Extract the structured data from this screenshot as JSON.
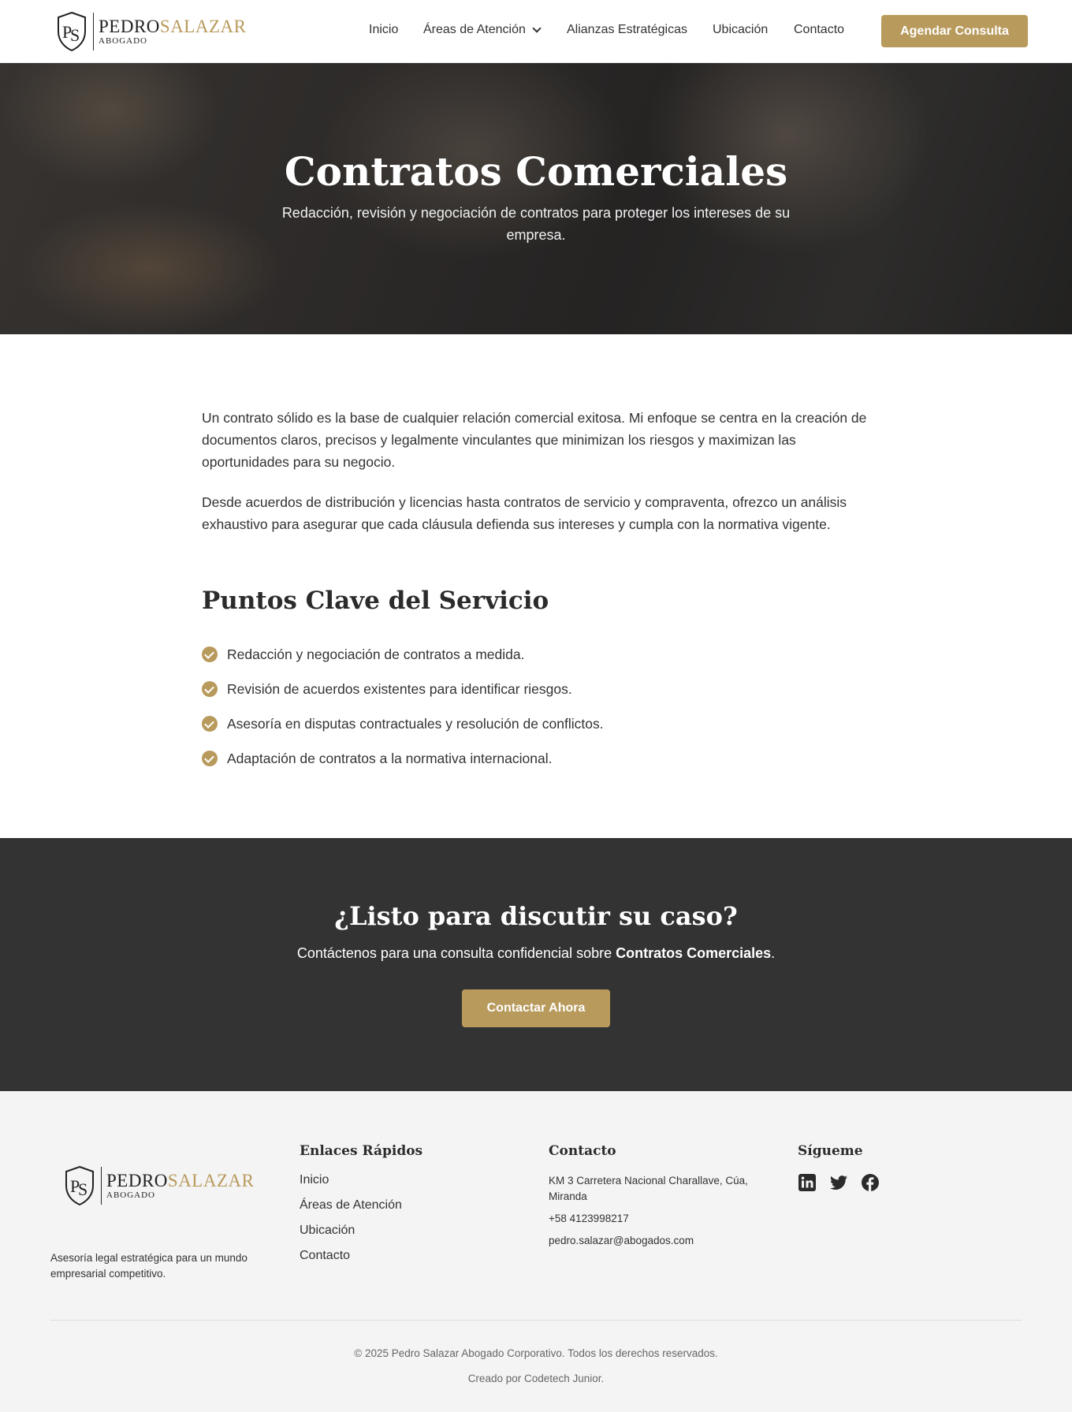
{
  "brand": {
    "first": "PEDRO",
    "last": "SALAZAR",
    "sub": "ABOGADO",
    "accent": "#b89a5c"
  },
  "nav": {
    "items": [
      "Inicio",
      "Áreas de Atención",
      "Alianzas Estratégicas",
      "Ubicación",
      "Contacto"
    ],
    "cta": "Agendar Consulta"
  },
  "hero": {
    "title": "Contratos Comerciales",
    "subtitle": "Redacción, revisión y negociación de contratos para proteger los intereses de su empresa."
  },
  "content": {
    "p1": "Un contrato sólido es la base de cualquier relación comercial exitosa. Mi enfoque se centra en la creación de documentos claros, precisos y legalmente vinculantes que minimizan los riesgos y maximizan las oportunidades para su negocio.",
    "p2": "Desde acuerdos de distribución y licencias hasta contratos de servicio y compraventa, ofrezco un análisis exhaustivo para asegurar que cada cláusula defienda sus intereses y cumpla con la normativa vigente.",
    "key_points_title": "Puntos Clave del Servicio",
    "key_points": [
      "Redacción y negociación de contratos a medida.",
      "Revisión de acuerdos existentes para identificar riesgos.",
      "Asesoría en disputas contractuales y resolución de conflictos.",
      "Adaptación de contratos a la normativa internacional."
    ]
  },
  "cta_band": {
    "title": "¿Listo para discutir su caso?",
    "text_prefix": "Contáctenos para una consulta confidencial sobre ",
    "text_bold": "Contratos Comerciales",
    "text_suffix": ".",
    "button": "Contactar Ahora",
    "bg": "#333333"
  },
  "footer": {
    "tagline": "Asesoría legal estratégica para un mundo empresarial competitivo.",
    "links_title": "Enlaces Rápidos",
    "links": [
      "Inicio",
      "Áreas de Atención",
      "Ubicación",
      "Contacto"
    ],
    "contact_title": "Contacto",
    "address": "KM 3 Carretera Nacional Charallave, Cúa, Miranda",
    "phone": "+58 4123998217",
    "email": "pedro.salazar@abogados.com",
    "social_title": "Sígueme",
    "socials": [
      "linkedin-icon",
      "twitter-icon",
      "facebook-icon"
    ],
    "copyright": "© 2025 Pedro Salazar Abogado Corporativo. Todos los derechos reservados.",
    "made_by": "Creado por Codetech Junior."
  }
}
